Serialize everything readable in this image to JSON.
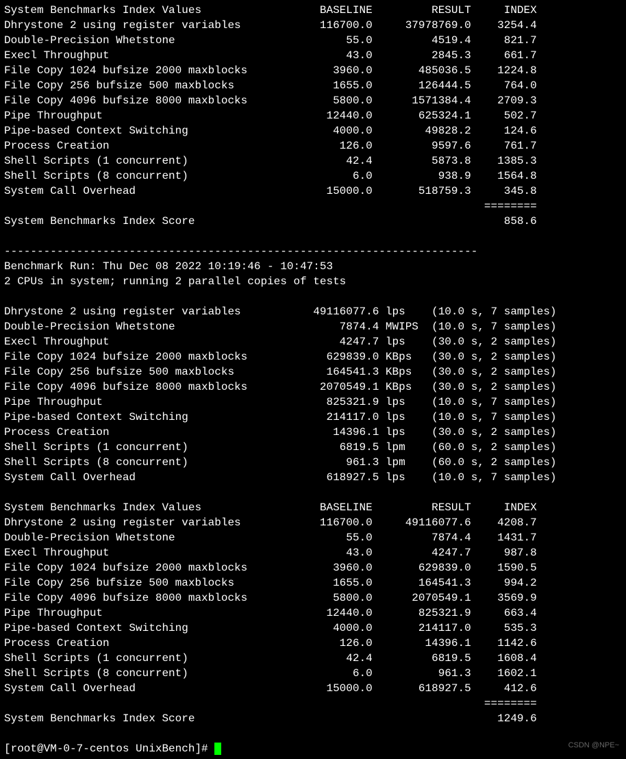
{
  "header1": {
    "title": "System Benchmarks Index Values",
    "col_baseline": "BASELINE",
    "col_result": "RESULT",
    "col_index": "INDEX"
  },
  "run1_index": [
    {
      "name": "Dhrystone 2 using register variables",
      "baseline": "116700.0",
      "result": "37978769.0",
      "index": "3254.4"
    },
    {
      "name": "Double-Precision Whetstone",
      "baseline": "55.0",
      "result": "4519.4",
      "index": "821.7"
    },
    {
      "name": "Execl Throughput",
      "baseline": "43.0",
      "result": "2845.3",
      "index": "661.7"
    },
    {
      "name": "File Copy 1024 bufsize 2000 maxblocks",
      "baseline": "3960.0",
      "result": "485036.5",
      "index": "1224.8"
    },
    {
      "name": "File Copy 256 bufsize 500 maxblocks",
      "baseline": "1655.0",
      "result": "126444.5",
      "index": "764.0"
    },
    {
      "name": "File Copy 4096 bufsize 8000 maxblocks",
      "baseline": "5800.0",
      "result": "1571384.4",
      "index": "2709.3"
    },
    {
      "name": "Pipe Throughput",
      "baseline": "12440.0",
      "result": "625324.1",
      "index": "502.7"
    },
    {
      "name": "Pipe-based Context Switching",
      "baseline": "4000.0",
      "result": "49828.2",
      "index": "124.6"
    },
    {
      "name": "Process Creation",
      "baseline": "126.0",
      "result": "9597.6",
      "index": "761.7"
    },
    {
      "name": "Shell Scripts (1 concurrent)",
      "baseline": "42.4",
      "result": "5873.8",
      "index": "1385.3"
    },
    {
      "name": "Shell Scripts (8 concurrent)",
      "baseline": "6.0",
      "result": "938.9",
      "index": "1564.8"
    },
    {
      "name": "System Call Overhead",
      "baseline": "15000.0",
      "result": "518759.3",
      "index": "345.8"
    }
  ],
  "run1_score_label": "System Benchmarks Index Score",
  "run1_score": "858.6",
  "divider": "------------------------------------------------------------------------",
  "run2_header": "Benchmark Run: Thu Dec 08 2022 10:19:46 - 10:47:53",
  "run2_cpus": "2 CPUs in system; running 2 parallel copies of tests",
  "run2_raw": [
    {
      "name": "Dhrystone 2 using register variables",
      "value": "49116077.6",
      "unit": "lps",
      "timing": "(10.0 s, 7 samples)"
    },
    {
      "name": "Double-Precision Whetstone",
      "value": "7874.4",
      "unit": "MWIPS",
      "timing": "(10.0 s, 7 samples)"
    },
    {
      "name": "Execl Throughput",
      "value": "4247.7",
      "unit": "lps",
      "timing": "(30.0 s, 2 samples)"
    },
    {
      "name": "File Copy 1024 bufsize 2000 maxblocks",
      "value": "629839.0",
      "unit": "KBps",
      "timing": "(30.0 s, 2 samples)"
    },
    {
      "name": "File Copy 256 bufsize 500 maxblocks",
      "value": "164541.3",
      "unit": "KBps",
      "timing": "(30.0 s, 2 samples)"
    },
    {
      "name": "File Copy 4096 bufsize 8000 maxblocks",
      "value": "2070549.1",
      "unit": "KBps",
      "timing": "(30.0 s, 2 samples)"
    },
    {
      "name": "Pipe Throughput",
      "value": "825321.9",
      "unit": "lps",
      "timing": "(10.0 s, 7 samples)"
    },
    {
      "name": "Pipe-based Context Switching",
      "value": "214117.0",
      "unit": "lps",
      "timing": "(10.0 s, 7 samples)"
    },
    {
      "name": "Process Creation",
      "value": "14396.1",
      "unit": "lps",
      "timing": "(30.0 s, 2 samples)"
    },
    {
      "name": "Shell Scripts (1 concurrent)",
      "value": "6819.5",
      "unit": "lpm",
      "timing": "(60.0 s, 2 samples)"
    },
    {
      "name": "Shell Scripts (8 concurrent)",
      "value": "961.3",
      "unit": "lpm",
      "timing": "(60.0 s, 2 samples)"
    },
    {
      "name": "System Call Overhead",
      "value": "618927.5",
      "unit": "lps",
      "timing": "(10.0 s, 7 samples)"
    }
  ],
  "header2": {
    "title": "System Benchmarks Index Values",
    "col_baseline": "BASELINE",
    "col_result": "RESULT",
    "col_index": "INDEX"
  },
  "run2_index": [
    {
      "name": "Dhrystone 2 using register variables",
      "baseline": "116700.0",
      "result": "49116077.6",
      "index": "4208.7"
    },
    {
      "name": "Double-Precision Whetstone",
      "baseline": "55.0",
      "result": "7874.4",
      "index": "1431.7"
    },
    {
      "name": "Execl Throughput",
      "baseline": "43.0",
      "result": "4247.7",
      "index": "987.8"
    },
    {
      "name": "File Copy 1024 bufsize 2000 maxblocks",
      "baseline": "3960.0",
      "result": "629839.0",
      "index": "1590.5"
    },
    {
      "name": "File Copy 256 bufsize 500 maxblocks",
      "baseline": "1655.0",
      "result": "164541.3",
      "index": "994.2"
    },
    {
      "name": "File Copy 4096 bufsize 8000 maxblocks",
      "baseline": "5800.0",
      "result": "2070549.1",
      "index": "3569.9"
    },
    {
      "name": "Pipe Throughput",
      "baseline": "12440.0",
      "result": "825321.9",
      "index": "663.4"
    },
    {
      "name": "Pipe-based Context Switching",
      "baseline": "4000.0",
      "result": "214117.0",
      "index": "535.3"
    },
    {
      "name": "Process Creation",
      "baseline": "126.0",
      "result": "14396.1",
      "index": "1142.6"
    },
    {
      "name": "Shell Scripts (1 concurrent)",
      "baseline": "42.4",
      "result": "6819.5",
      "index": "1608.4"
    },
    {
      "name": "Shell Scripts (8 concurrent)",
      "baseline": "6.0",
      "result": "961.3",
      "index": "1602.1"
    },
    {
      "name": "System Call Overhead",
      "baseline": "15000.0",
      "result": "618927.5",
      "index": "412.6"
    }
  ],
  "run2_score_label": "System Benchmarks Index Score",
  "run2_score": "1249.6",
  "equals": "========",
  "prompt": "[root@VM-0-7-centos UnixBench]# ",
  "watermark": "CSDN @NPE~"
}
